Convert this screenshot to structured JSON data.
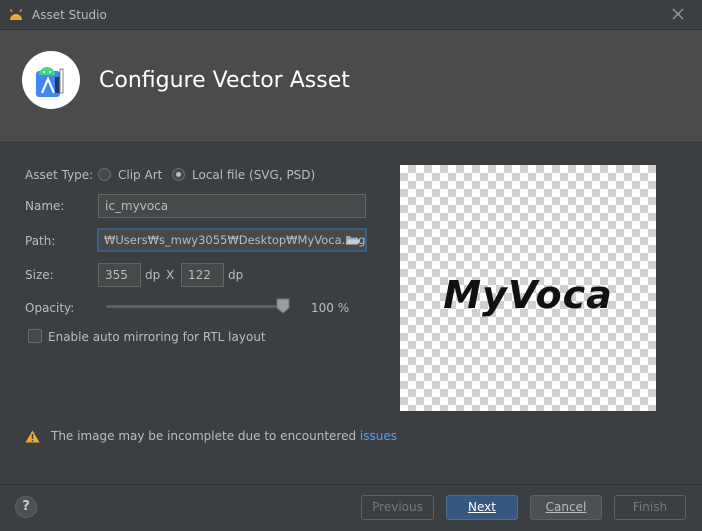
{
  "window": {
    "title": "Asset Studio"
  },
  "header": {
    "title": "Configure Vector Asset"
  },
  "form": {
    "asset_type_label": "Asset Type:",
    "asset_type_options": [
      "Clip Art",
      "Local file (SVG, PSD)"
    ],
    "asset_type_selected": "Local file (SVG, PSD)",
    "name_label": "Name:",
    "name_value": "ic_myvoca",
    "path_label": "Path:",
    "path_value": "₩Users₩s_mwy3055₩Desktop₩MyVoca.svg",
    "size_label": "Size:",
    "size_width": "355",
    "size_height": "122",
    "size_unit": "dp",
    "size_separator": "X",
    "opacity_label": "Opacity:",
    "opacity_value": "100 %",
    "opacity_level": 1.0,
    "auto_mirror_label": "Enable auto mirroring for RTL layout",
    "auto_mirror_checked": false
  },
  "preview": {
    "text": "MyVoca"
  },
  "warning": {
    "text": "The image may be incomplete due to encountered ",
    "link": "issues"
  },
  "footer": {
    "help_label": "?",
    "previous_label": "Previous",
    "next_label": "Next",
    "cancel_label": "Cancel",
    "finish_label": "Finish"
  },
  "colors": {
    "accent": "#365880",
    "link": "#589df6",
    "warning": "#f0a732",
    "background": "#3c3f41"
  }
}
